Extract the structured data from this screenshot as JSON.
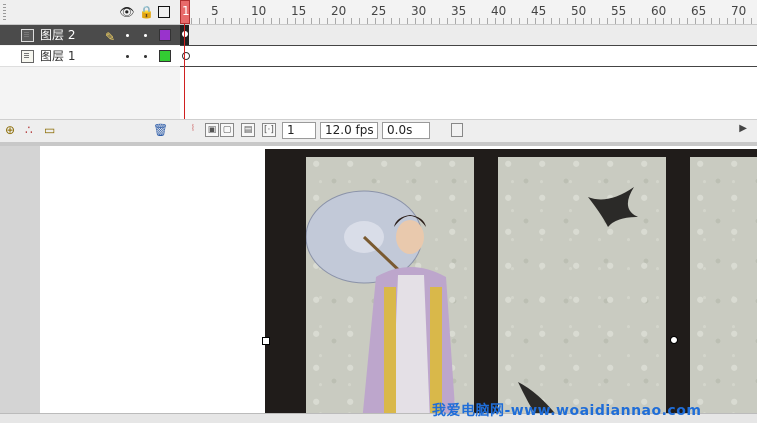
{
  "timeline": {
    "header_icons": [
      "eye-icon",
      "lock-icon",
      "outline-icon"
    ],
    "frame_numbers": [
      "1",
      "5",
      "10",
      "15",
      "20",
      "25",
      "30",
      "35",
      "40",
      "45",
      "50",
      "55",
      "60",
      "65",
      "70"
    ],
    "layers": [
      {
        "name": "图层 2",
        "selected": true,
        "color": "#9933cc",
        "editing_icon": "pencil-icon"
      },
      {
        "name": "图层 1",
        "selected": false,
        "color": "#33cc33"
      }
    ],
    "layer_tools": [
      "insert-layer-icon",
      "add-motion-guide-icon",
      "insert-folder-icon",
      "delete-layer-icon"
    ],
    "current_frame": "1",
    "frame_rate": "12.0 fps",
    "elapsed_time": "0.0s"
  },
  "stage": {
    "watermark": "我爱电脑网-www.woaidiannao.com"
  },
  "colors": {
    "playhead": "#e86a6a",
    "selected_layer_bg": "#4b4b4b",
    "watermark": "#1f6dd8"
  }
}
